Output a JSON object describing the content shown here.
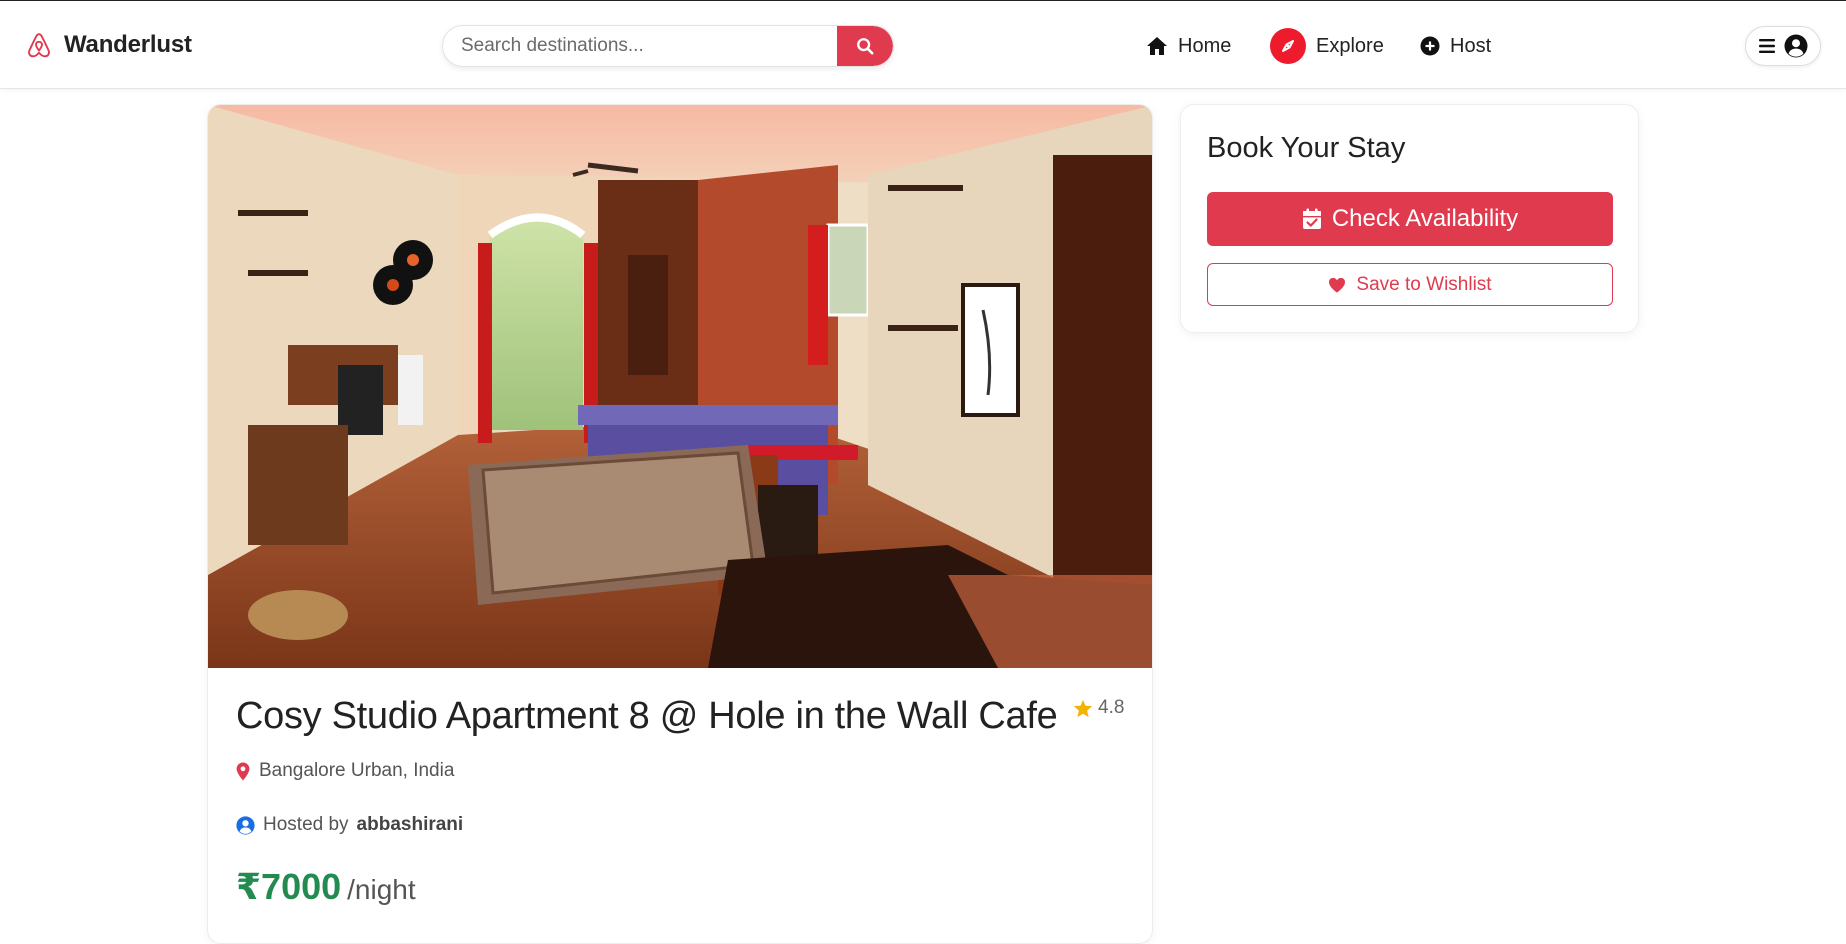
{
  "colors": {
    "brand": "#e03a4f",
    "explore_badge": "#ee1b2c",
    "price": "#238b50",
    "rating_star": "#f5b301",
    "host_icon": "#1a6fe0"
  },
  "navbar": {
    "brand_name": "Wanderlust",
    "brand_icon": "airbnb-logo-icon",
    "search": {
      "placeholder": "Search destinations...",
      "value": "",
      "button_icon": "search-icon"
    },
    "links": [
      {
        "label": "Home",
        "icon": "home-icon"
      },
      {
        "label": "Explore",
        "icon": "compass-icon"
      },
      {
        "label": "Host",
        "icon": "plus-circle-icon"
      }
    ],
    "user_menu_icons": [
      "menu-icon",
      "user-circle-icon"
    ]
  },
  "listing": {
    "photo_alt": "Studio apartment interior",
    "title": "Cosy Studio Apartment 8 @ Hole in the Wall Cafe",
    "rating": "4.8",
    "location": "Bangalore Urban, India",
    "hosted_by_label": "Hosted by",
    "host_name": "abbashirani",
    "price": "₹7000",
    "price_unit": "/night"
  },
  "booking": {
    "title": "Book Your Stay",
    "check_availability_label": "Check Availability",
    "save_wishlist_label": "Save to Wishlist"
  }
}
